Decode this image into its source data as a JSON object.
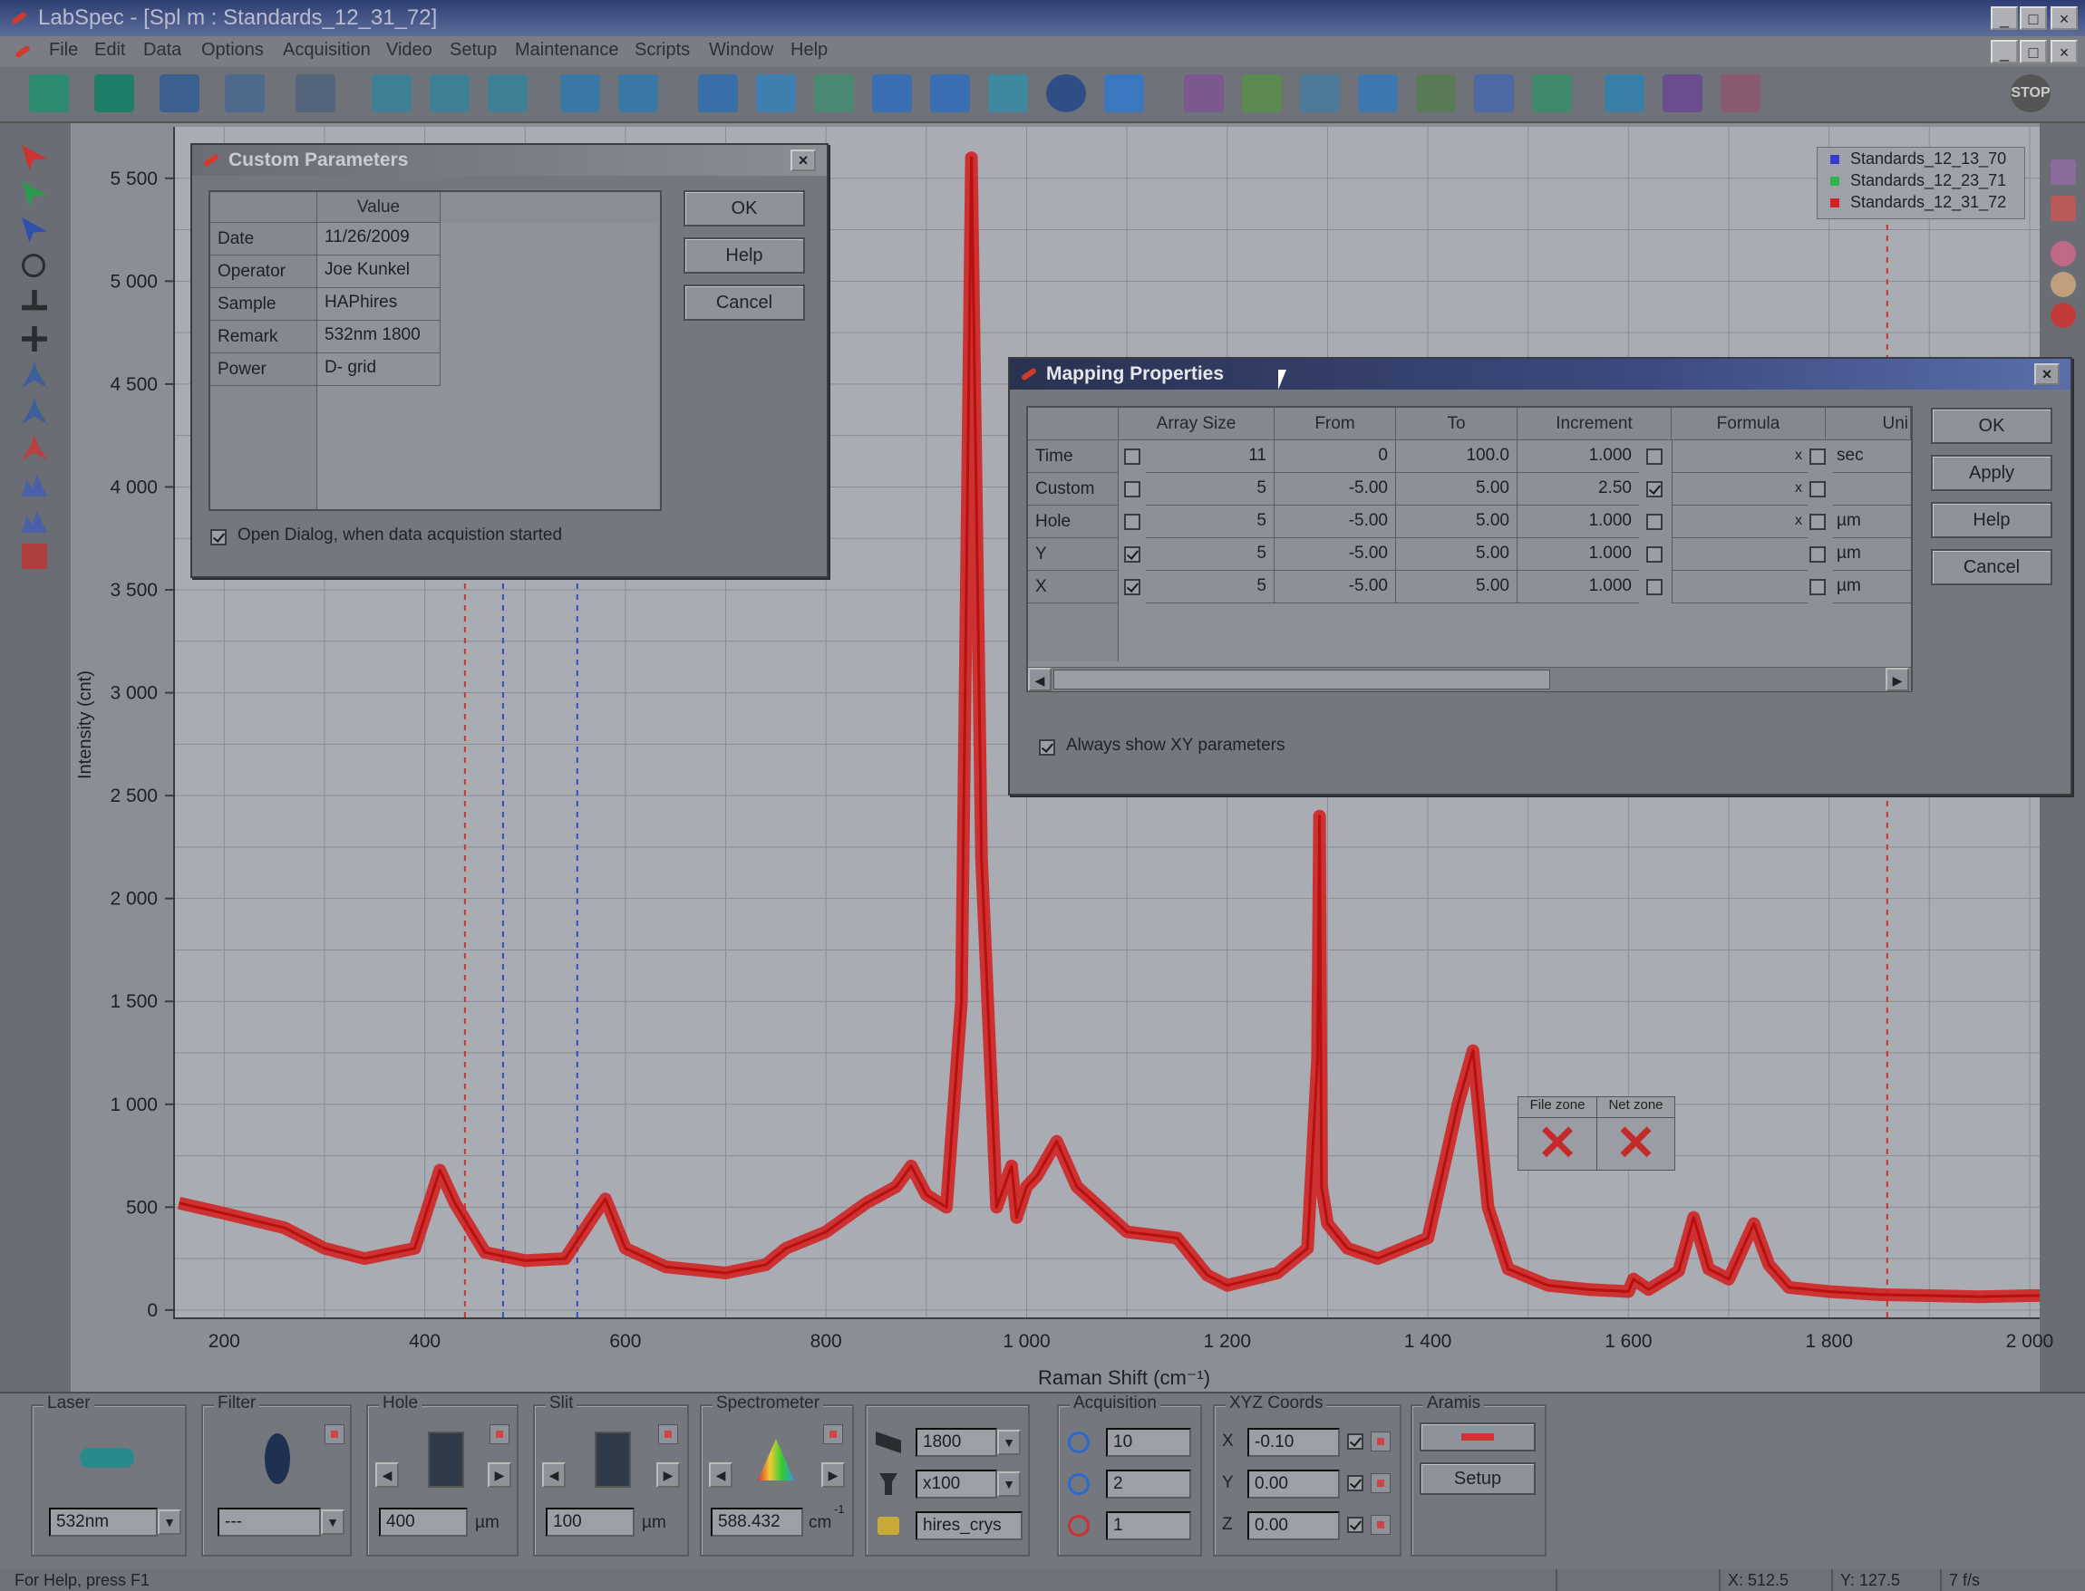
{
  "window": {
    "title": "LabSpec - [Spl m : Standards_12_31_72]"
  },
  "menu": [
    "File",
    "Edit",
    "Data",
    "Options",
    "Acquisition",
    "Video",
    "Setup",
    "Maintenance",
    "Scripts",
    "Window",
    "Help"
  ],
  "toolbar": {
    "stop_label": "STOP"
  },
  "chart_data": {
    "type": "line",
    "xlabel": "Raman Shift (cm⁻¹)",
    "ylabel": "Intensity (cnt)",
    "xlim": [
      150,
      2010
    ],
    "ylim": [
      -40,
      5750
    ],
    "x_ticks": [
      "200",
      "400",
      "600",
      "800",
      "1 000",
      "1 200",
      "1 400",
      "1 600",
      "1 800",
      "2 000"
    ],
    "y_ticks": [
      "0",
      "500",
      "1 000",
      "1 500",
      "2 000",
      "2 500",
      "3 000",
      "3 500",
      "4 000",
      "4 500",
      "5 000",
      "5 500"
    ],
    "x_tick_values": [
      200,
      400,
      600,
      800,
      1000,
      1200,
      1400,
      1600,
      1800,
      2000
    ],
    "y_tick_values": [
      0,
      500,
      1000,
      1500,
      2000,
      2500,
      3000,
      3500,
      4000,
      4500,
      5000,
      5500
    ],
    "grid": true,
    "legend_position": "top-right",
    "legend": [
      {
        "name": "Standards_12_13_70",
        "color": "#3a3ad0"
      },
      {
        "name": "Standards_12_23_71",
        "color": "#2fb34a"
      },
      {
        "name": "Standards_12_31_72",
        "color": "#d42020"
      }
    ],
    "series": [
      {
        "name": "Standards_12_31_72",
        "color": "#d41c1c",
        "x": [
          155,
          200,
          260,
          300,
          340,
          390,
          415,
          430,
          460,
          500,
          540,
          570,
          580,
          600,
          640,
          700,
          740,
          760,
          800,
          840,
          870,
          885,
          900,
          920,
          935,
          945,
          955,
          970,
          985,
          990,
          1000,
          1010,
          1030,
          1050,
          1100,
          1150,
          1180,
          1200,
          1250,
          1280,
          1290,
          1292,
          1294,
          1300,
          1320,
          1350,
          1400,
          1430,
          1445,
          1460,
          1480,
          1520,
          1560,
          1600,
          1605,
          1620,
          1650,
          1665,
          1680,
          1700,
          1725,
          1740,
          1760,
          1800,
          1850,
          1900,
          1950,
          2000,
          2010
        ],
        "y": [
          520,
          470,
          400,
          300,
          250,
          300,
          680,
          520,
          280,
          240,
          250,
          470,
          540,
          300,
          210,
          180,
          220,
          300,
          380,
          520,
          600,
          700,
          560,
          500,
          1500,
          5600,
          2200,
          500,
          700,
          450,
          600,
          650,
          820,
          600,
          380,
          350,
          170,
          120,
          180,
          300,
          1220,
          2400,
          600,
          420,
          300,
          250,
          350,
          1000,
          1260,
          500,
          200,
          120,
          100,
          90,
          150,
          100,
          190,
          450,
          200,
          150,
          420,
          220,
          110,
          90,
          75,
          70,
          65,
          70,
          70
        ]
      }
    ],
    "vertical_markers": [
      {
        "x": 440,
        "color": "#d03030"
      },
      {
        "x": 478,
        "color": "#3050c0"
      },
      {
        "x": 552,
        "color": "#3050c0"
      },
      {
        "x": 1858,
        "color": "#d03030"
      }
    ]
  },
  "zones": {
    "file_zone": "File zone",
    "net_zone": "Net zone"
  },
  "custom_params": {
    "title": "Custom Parameters",
    "header_value": "Value",
    "rows": [
      {
        "name": "Date",
        "value": "11/26/2009"
      },
      {
        "name": "Operator",
        "value": "Joe Kunkel"
      },
      {
        "name": "Sample",
        "value": "HAPhires"
      },
      {
        "name": "Remark",
        "value": "532nm 1800"
      },
      {
        "name": "Power",
        "value": "D- grid"
      }
    ],
    "ok": "OK",
    "help": "Help",
    "cancel": "Cancel",
    "open_dialog_label": "Open Dialog, when data acquistion started"
  },
  "mapping": {
    "title": "Mapping Properties",
    "headers": [
      "Array Size",
      "From",
      "To",
      "Increment",
      "Formula",
      "Uni"
    ],
    "rows": [
      {
        "name": "Time",
        "cb1": false,
        "size": "11",
        "from": "0",
        "to": "100.0",
        "inc": "1.000",
        "cb2": false,
        "x": "x",
        "cb3": false,
        "unit": "sec"
      },
      {
        "name": "Custom",
        "cb1": false,
        "size": "5",
        "from": "-5.00",
        "to": "5.00",
        "inc": "2.50",
        "cb2": true,
        "x": "x",
        "cb3": false,
        "unit": ""
      },
      {
        "name": "Hole",
        "cb1": false,
        "size": "5",
        "from": "-5.00",
        "to": "5.00",
        "inc": "1.000",
        "cb2": false,
        "x": "x",
        "cb3": false,
        "unit": "µm"
      },
      {
        "name": "Y",
        "cb1": true,
        "size": "5",
        "from": "-5.00",
        "to": "5.00",
        "inc": "1.000",
        "cb2": false,
        "x": "",
        "cb3": false,
        "unit": "µm"
      },
      {
        "name": "X",
        "cb1": true,
        "size": "5",
        "from": "-5.00",
        "to": "5.00",
        "inc": "1.000",
        "cb2": false,
        "x": "",
        "cb3": false,
        "unit": "µm"
      }
    ],
    "ok": "OK",
    "apply": "Apply",
    "help": "Help",
    "cancel": "Cancel",
    "always_show_label": "Always show XY parameters"
  },
  "bottom": {
    "laser": {
      "label": "Laser",
      "value": "532nm"
    },
    "filter": {
      "label": "Filter",
      "value": "---"
    },
    "hole": {
      "label": "Hole",
      "value": "400",
      "unit": "µm"
    },
    "slit": {
      "label": "Slit",
      "value": "100",
      "unit": "µm"
    },
    "spectrometer": {
      "label": "Spectrometer",
      "value": "588.432",
      "unit": "cm",
      "sup": "-1"
    },
    "grating": {
      "value": "1800",
      "objective": "x100",
      "config": "hires_crys"
    },
    "acquisition": {
      "label": "Acquisition",
      "time": "10",
      "accum": "2",
      "count": "1"
    },
    "xyz": {
      "label": "XYZ Coords",
      "x_label": "X",
      "x": "-0.10",
      "y_label": "Y",
      "y": "0.00",
      "z_label": "Z",
      "z": "0.00"
    },
    "aramis": {
      "label": "Aramis",
      "setup": "Setup"
    }
  },
  "status": {
    "help": "For Help, press F1",
    "x": "X: 512.5",
    "y": "Y: 127.5",
    "fps": "7 f/s"
  }
}
